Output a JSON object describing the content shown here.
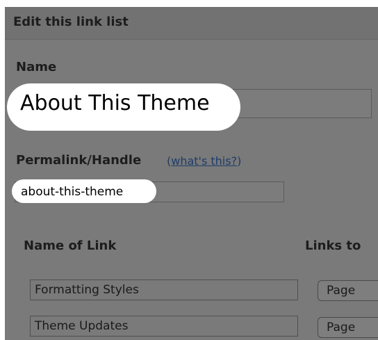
{
  "header": {
    "title": "Edit this link list"
  },
  "name": {
    "label": "Name",
    "value": "About This Theme"
  },
  "permalink": {
    "label": "Permalink/Handle",
    "help_open": "(",
    "help_link": "what's this?",
    "help_close": ")",
    "value": "about-this-theme"
  },
  "links": {
    "col_name": "Name of Link",
    "col_links_to": "Links to",
    "rows": [
      {
        "name": "Formatting Styles",
        "type": "Page"
      },
      {
        "name": "Theme Updates",
        "type": "Page"
      }
    ]
  }
}
